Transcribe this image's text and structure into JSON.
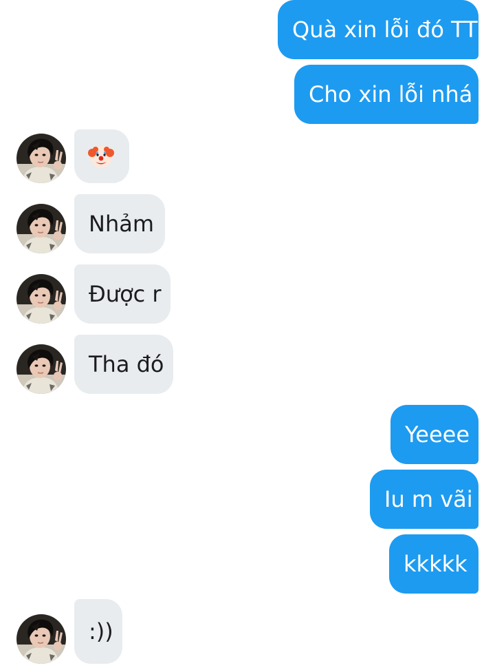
{
  "colors": {
    "outgoing_bubble": "#1d9bf0",
    "outgoing_text": "#ffffff",
    "incoming_bubble": "#e8ecef",
    "incoming_text": "#1c1c1e"
  },
  "messages": [
    {
      "direction": "outgoing",
      "text": "Quà xin lỗi đó TT"
    },
    {
      "direction": "outgoing",
      "text": "Cho xin lỗi nhá"
    },
    {
      "direction": "incoming",
      "text": "",
      "emoji": "clown-face-emoji",
      "avatar": "contact-avatar"
    },
    {
      "direction": "incoming",
      "text": "Nhảm",
      "avatar": "contact-avatar"
    },
    {
      "direction": "incoming",
      "text": "Được r",
      "avatar": "contact-avatar"
    },
    {
      "direction": "incoming",
      "text": "Tha đó",
      "avatar": "contact-avatar"
    },
    {
      "direction": "outgoing",
      "text": "Yeeee"
    },
    {
      "direction": "outgoing",
      "text": "Iu m vãi"
    },
    {
      "direction": "outgoing",
      "text": "kkkkk"
    },
    {
      "direction": "incoming",
      "text": ":))",
      "avatar": "contact-avatar"
    }
  ]
}
